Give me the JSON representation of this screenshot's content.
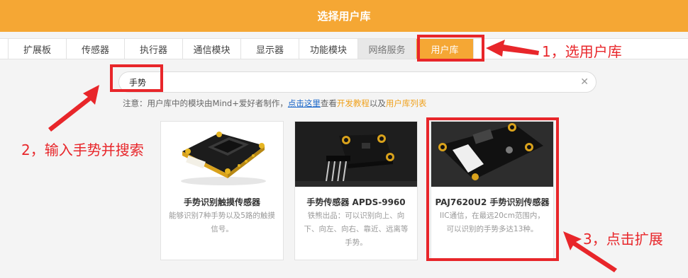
{
  "window": {
    "title": "选择用户库"
  },
  "tabs": [
    {
      "label": "扩展板",
      "state": "normal"
    },
    {
      "label": "传感器",
      "state": "normal"
    },
    {
      "label": "执行器",
      "state": "normal"
    },
    {
      "label": "通信模块",
      "state": "normal"
    },
    {
      "label": "显示器",
      "state": "normal"
    },
    {
      "label": "功能模块",
      "state": "normal"
    },
    {
      "label": "网络服务",
      "state": "gray"
    },
    {
      "label": "用户库",
      "state": "active"
    }
  ],
  "search": {
    "value": "手势",
    "clear_icon": "✕"
  },
  "note": {
    "prefix": "注意：用户库中的模块由Mind+爱好者制作，",
    "link": "点击这里",
    "middle": "查看",
    "tutorial": "开发教程",
    "and": "以及",
    "list": "用户库列表"
  },
  "cards": [
    {
      "name": "手势识别触摸传感器",
      "desc": "能够识别7种手势以及5路的触摸信号。"
    },
    {
      "name": "手势传感器 APDS-9960",
      "desc": "铁熊出品：可以识别向上、向下、向左、向右、靠近、远离等手势。"
    },
    {
      "name": "PAJ7620U2 手势识别传感器",
      "desc": "IIC通信，在最远20cm范围内，可以识别的手势多达13种。"
    }
  ],
  "annotations": {
    "step1": "1，选用户库",
    "step2": "2，输入手势并搜索",
    "step3": "3，点击扩展"
  },
  "colors": {
    "title_bar": "#f5a734",
    "active_tab": "#f5a734",
    "annotation": "#e8262a",
    "link": "#1a66c8"
  }
}
